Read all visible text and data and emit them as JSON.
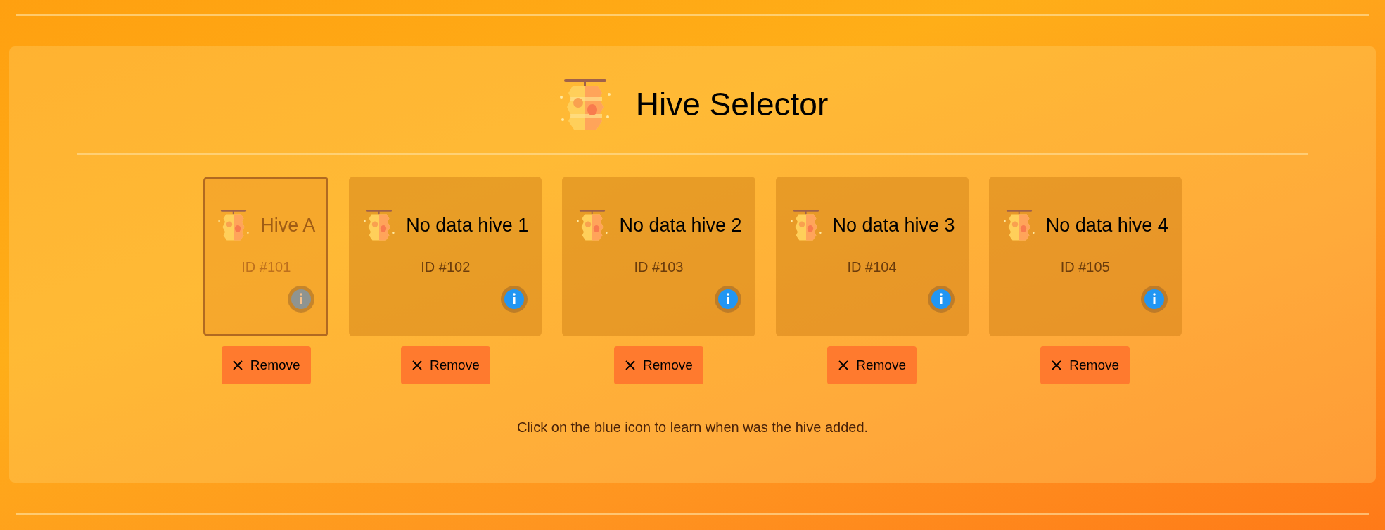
{
  "title": "Hive Selector",
  "hives": [
    {
      "name": "Hive A",
      "id": "ID #101",
      "selected": true,
      "remove": "Remove"
    },
    {
      "name": "No data hive 1",
      "id": "ID #102",
      "selected": false,
      "remove": "Remove"
    },
    {
      "name": "No data hive 2",
      "id": "ID #103",
      "selected": false,
      "remove": "Remove"
    },
    {
      "name": "No data hive 3",
      "id": "ID #104",
      "selected": false,
      "remove": "Remove"
    },
    {
      "name": "No data hive 4",
      "id": "ID #105",
      "selected": false,
      "remove": "Remove"
    }
  ],
  "hint": "Click on the blue icon to learn when was the hive added."
}
